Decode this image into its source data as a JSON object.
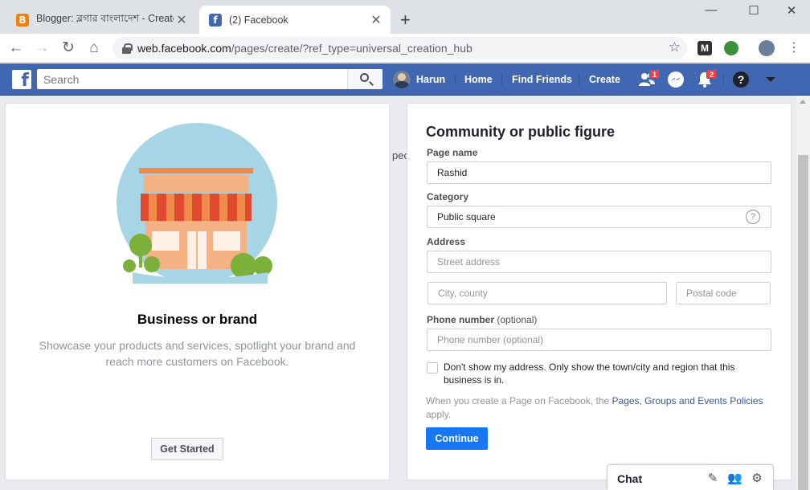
{
  "browser": {
    "tabs": [
      {
        "title": "Blogger: ব্লগার বাংলাদেশ - Create",
        "favicon": "blogger-icon",
        "active": false
      },
      {
        "title": "(2) Facebook",
        "favicon": "facebook-icon",
        "active": true
      }
    ],
    "url_host": "web.facebook.com",
    "url_path": "/pages/create/?ref_type=universal_creation_hub"
  },
  "fb": {
    "search_placeholder": "Search",
    "user_name": "Harun",
    "nav": [
      "Home",
      "Find Friends",
      "Create"
    ],
    "friend_requests_badge": "1",
    "notifications_badge": "2",
    "brand_color": "#4267b2"
  },
  "left": {
    "title": "Business or brand",
    "description": "Showcase your products and services, spotlight your brand and reach more customers on Facebook.",
    "button": "Get Started"
  },
  "peek_text": "peo",
  "form": {
    "title": "Community or public figure",
    "page_name_label": "Page name",
    "page_name_value": "Rashid",
    "category_label": "Category",
    "category_value": "Public square",
    "address_label": "Address",
    "street_placeholder": "Street address",
    "city_placeholder": "City, county",
    "postal_placeholder": "Postal code",
    "phone_label": "Phone number",
    "phone_optional": "(optional)",
    "phone_placeholder": "Phone number (optional)",
    "hide_address_label": "Don't show my address. Only show the town/city and region that this business is in.",
    "policy_prefix": "When you create a Page on Facebook, the ",
    "policy_link": "Pages, Groups and Events Policies",
    "policy_suffix": " apply.",
    "continue_label": "Continue"
  },
  "chat": {
    "label": "Chat"
  }
}
